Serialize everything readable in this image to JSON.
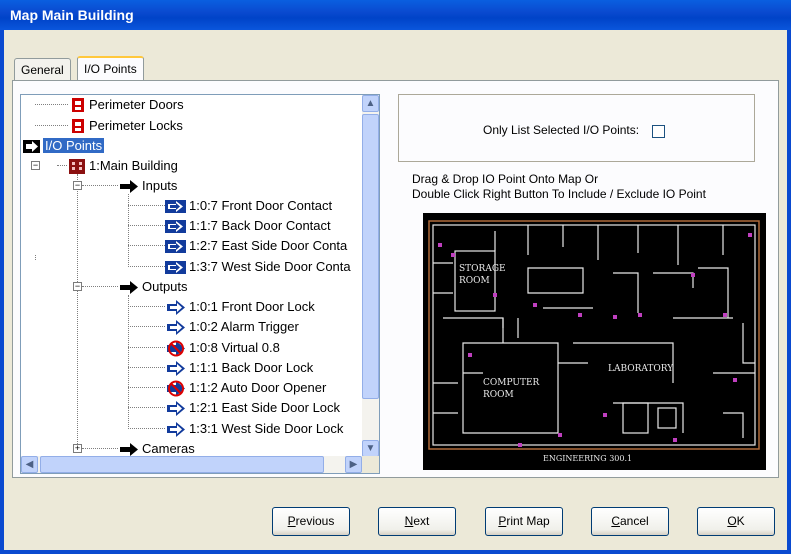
{
  "window": {
    "title": "Map Main Building"
  },
  "tabs": [
    {
      "label": "General",
      "active": false
    },
    {
      "label": "I/O Points",
      "active": true
    }
  ],
  "tree": {
    "items": [
      {
        "label": "Perimeter Doors",
        "icon": "door-group-icon"
      },
      {
        "label": "Perimeter Locks",
        "icon": "lock-group-icon"
      },
      {
        "label": "I/O Points",
        "icon": "arrow-right-icon",
        "selected": true
      },
      {
        "label": "1:Main Building",
        "icon": "building-icon"
      },
      {
        "label": "Inputs",
        "icon": "black-arrow-icon"
      },
      {
        "label": "1:0:7  Front Door Contact",
        "icon": "input-point-icon"
      },
      {
        "label": "1:1:7  Back Door Contact",
        "icon": "input-point-icon"
      },
      {
        "label": "1:2:7  East Side Door Conta",
        "icon": "input-point-icon"
      },
      {
        "label": "1:3:7  West Side Door Conta",
        "icon": "input-point-icon"
      },
      {
        "label": "Outputs",
        "icon": "black-arrow-icon"
      },
      {
        "label": "1:0:1  Front Door Lock",
        "icon": "output-point-icon"
      },
      {
        "label": "1:0:2  Alarm Trigger",
        "icon": "output-point-icon"
      },
      {
        "label": "1:0:8  Virtual 0.8",
        "icon": "output-disabled-icon"
      },
      {
        "label": "1:1:1  Back Door Lock",
        "icon": "output-point-icon"
      },
      {
        "label": "1:1:2  Auto Door Opener",
        "icon": "output-disabled-icon"
      },
      {
        "label": "1:2:1  East Side Door Lock",
        "icon": "output-point-icon"
      },
      {
        "label": "1:3:1  West Side Door Lock",
        "icon": "output-point-icon"
      },
      {
        "label": "Cameras",
        "icon": "black-arrow-icon"
      }
    ]
  },
  "options": {
    "only_selected_label": "Only List Selected I/O Points:",
    "only_selected_checked": false
  },
  "instructions": {
    "line1": "Drag & Drop IO Point Onto Map Or",
    "line2": "Double Click Right Button To Include / Exclude IO Point"
  },
  "map": {
    "labels": {
      "storage": "STORAGE ROOM",
      "computer": "COMPUTER ROOM",
      "laboratory": "LABORATORY",
      "footer": "ENGINEERING 300.1"
    }
  },
  "buttons": {
    "previous": {
      "mnemonic": "P",
      "rest": "revious"
    },
    "next": {
      "mnemonic": "N",
      "rest": "ext"
    },
    "print": {
      "mnemonic": "P",
      "rest": "rint Map"
    },
    "cancel": {
      "mnemonic": "C",
      "rest": "ancel"
    },
    "ok": {
      "mnemonic": "O",
      "rest": "K"
    }
  },
  "colors": {
    "title_bar": "#0a4ad0",
    "selection": "#316ac5",
    "map_bg": "#000000",
    "map_lines": "#ffffff"
  }
}
